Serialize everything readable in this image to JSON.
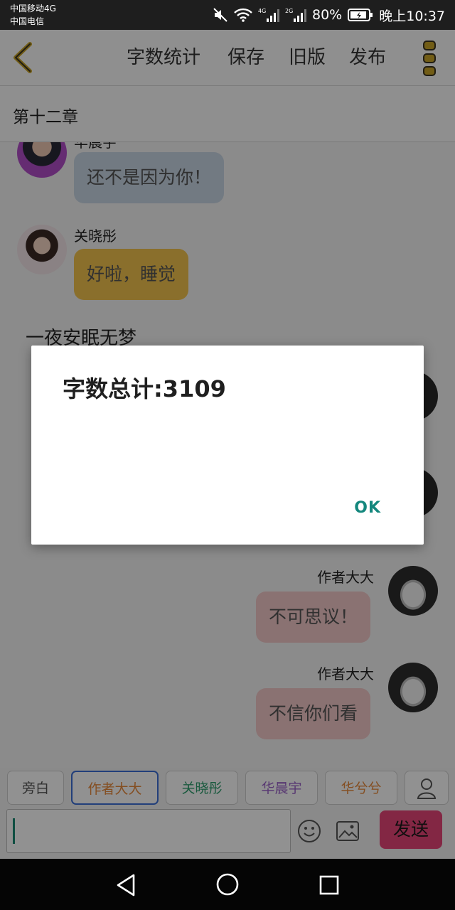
{
  "status_bar": {
    "carrier_1": "中国移动4G",
    "carrier_2": "中国电信",
    "signal_1_label": "4G",
    "signal_2_label": "2G",
    "battery": "80%",
    "time": "晚上10:37"
  },
  "toolbar": {
    "word_count": "字数统计",
    "save": "保存",
    "old_version": "旧版",
    "publish": "发布",
    "accent_color": "#c9a428"
  },
  "chapter_title": "第十二章",
  "chat": {
    "messages": [
      {
        "speaker": "华晨宇",
        "text": "还不是因为你！",
        "side": "left",
        "bubble_color": "#c9d6e4"
      },
      {
        "speaker": "关晓彤",
        "text": "好啦，睡觉",
        "side": "left",
        "bubble_color": "#f2c34e"
      },
      {
        "speaker": "作者大大",
        "text": "不可思议！",
        "side": "right",
        "bubble_color": "#f2c8c8"
      },
      {
        "speaker": "作者大大",
        "text": "不信你们看",
        "side": "right",
        "bubble_color": "#f2c8c8"
      }
    ],
    "narration": "一夜安眠无梦"
  },
  "role_chips": [
    {
      "label": "旁白",
      "color": "#555555"
    },
    {
      "label": "作者大大",
      "color": "#e8893a"
    },
    {
      "label": "关晓彤",
      "color": "#2f9e6e"
    },
    {
      "label": "华晨宇",
      "color": "#9b63c9"
    },
    {
      "label": "华兮兮",
      "color": "#e8893a"
    }
  ],
  "composer": {
    "value": "",
    "send": "发送"
  },
  "dialog": {
    "message": "字数总计:3109",
    "ok": "OK"
  },
  "icons": [
    "back-icon",
    "more-icon",
    "person-icon",
    "emoji-icon",
    "image-icon",
    "nav-back-icon",
    "nav-home-icon",
    "nav-recents-icon"
  ]
}
